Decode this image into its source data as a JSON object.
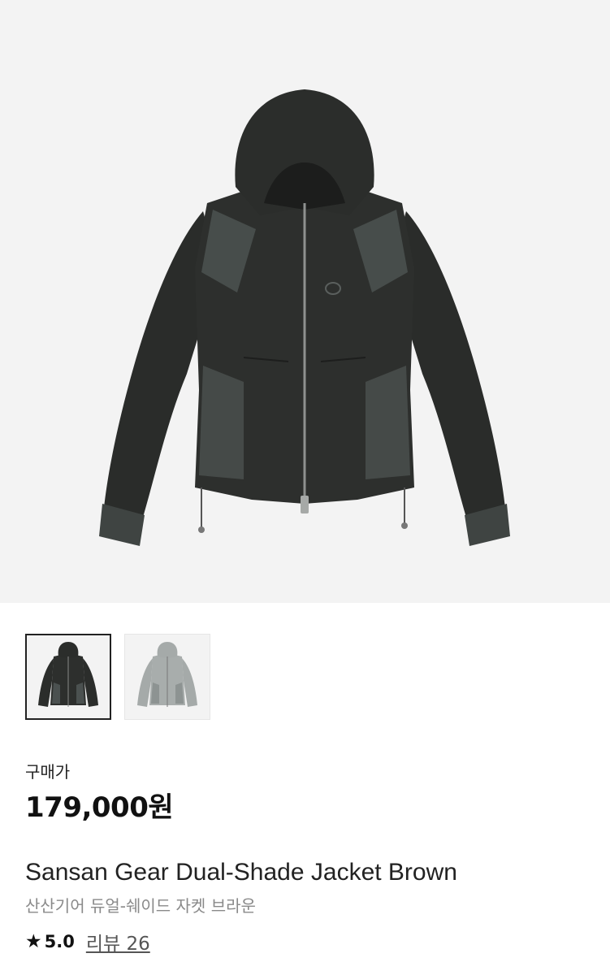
{
  "product": {
    "images": [
      {
        "name": "jacket-black-image",
        "color": "#2b2d2b",
        "accent": "#4b5150"
      },
      {
        "name": "jacket-gray-image",
        "color": "#a5aaa9",
        "accent": "#8d9392"
      }
    ],
    "selected_image": 0,
    "price_label": "구매가",
    "price": "179,000원",
    "name_en": "Sansan Gear Dual-Shade Jacket Brown",
    "name_ko": "산산기어 듀얼-쉐이드 자켓 브라운",
    "rating": "5.0",
    "reviews_label": "리뷰 26",
    "star_icon": "star-icon"
  }
}
